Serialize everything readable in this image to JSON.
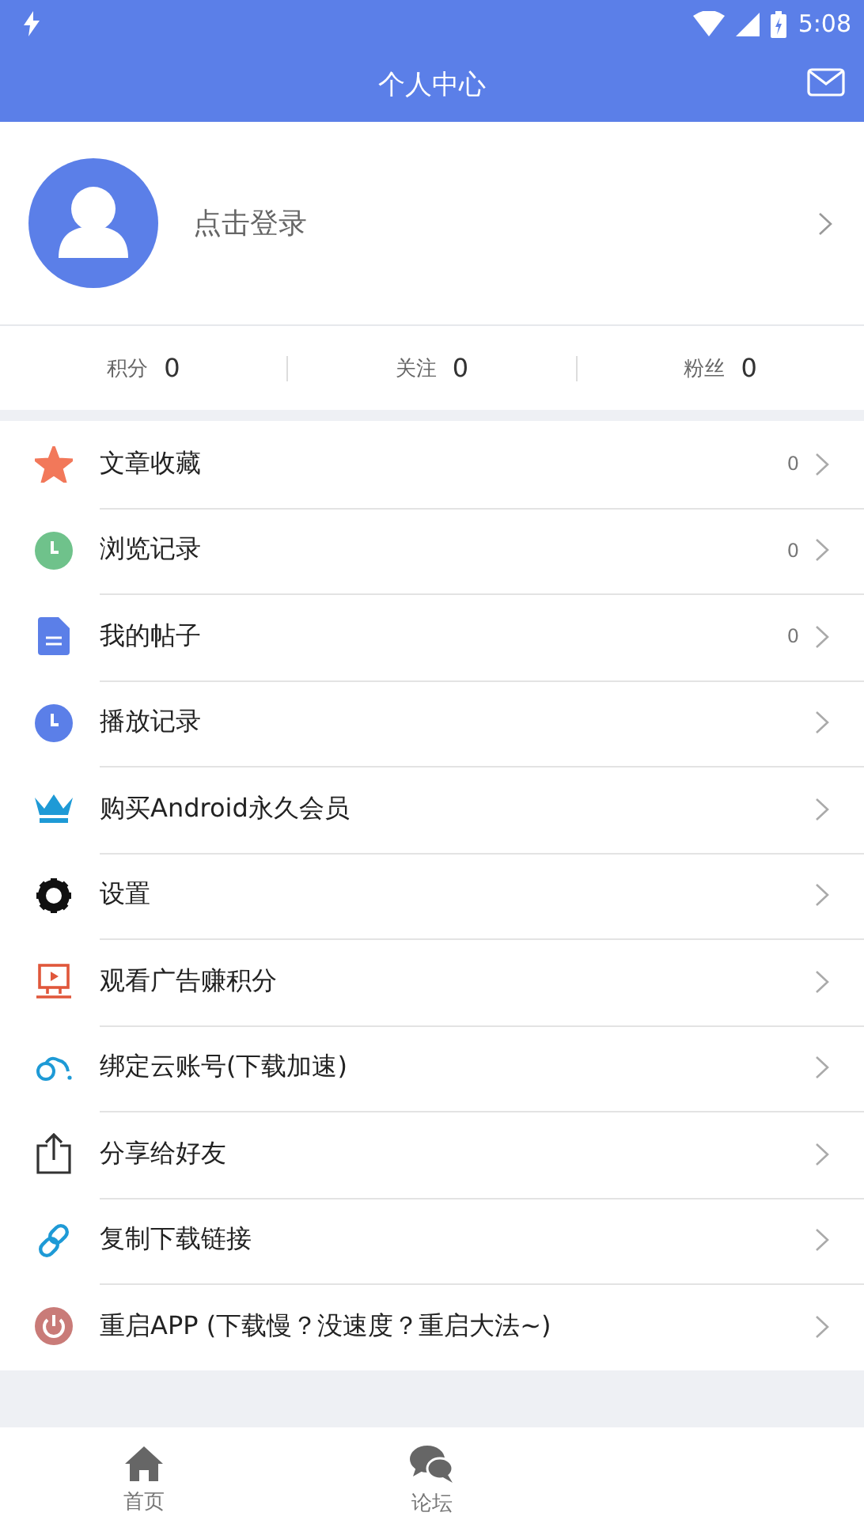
{
  "status_bar": {
    "time": "5:08"
  },
  "app_bar": {
    "title": "个人中心"
  },
  "profile": {
    "login_prompt": "点击登录"
  },
  "stats": [
    {
      "label": "积分",
      "value": "0"
    },
    {
      "label": "关注",
      "value": "0"
    },
    {
      "label": "粉丝",
      "value": "0"
    }
  ],
  "menu": [
    {
      "kind": "star",
      "label": "文章收藏",
      "count": "0"
    },
    {
      "kind": "clock-green",
      "label": "浏览记录",
      "count": "0"
    },
    {
      "kind": "document",
      "label": "我的帖子",
      "count": "0"
    },
    {
      "kind": "clock-blue",
      "label": "播放记录"
    },
    {
      "kind": "crown",
      "label": "购买Android永久会员"
    },
    {
      "kind": "gear",
      "label": "设置"
    },
    {
      "kind": "monitor",
      "label": "观看广告赚积分"
    },
    {
      "kind": "cloud",
      "label": "绑定云账号(下载加速)"
    },
    {
      "kind": "share",
      "label": "分享给好友"
    },
    {
      "kind": "link",
      "label": "复制下载链接"
    },
    {
      "kind": "power",
      "label": "重启APP (下载慢？没速度？重启大法~)"
    }
  ],
  "bottom_nav": [
    {
      "kind": "home",
      "label": "首页"
    },
    {
      "kind": "chat",
      "label": "论坛"
    }
  ]
}
